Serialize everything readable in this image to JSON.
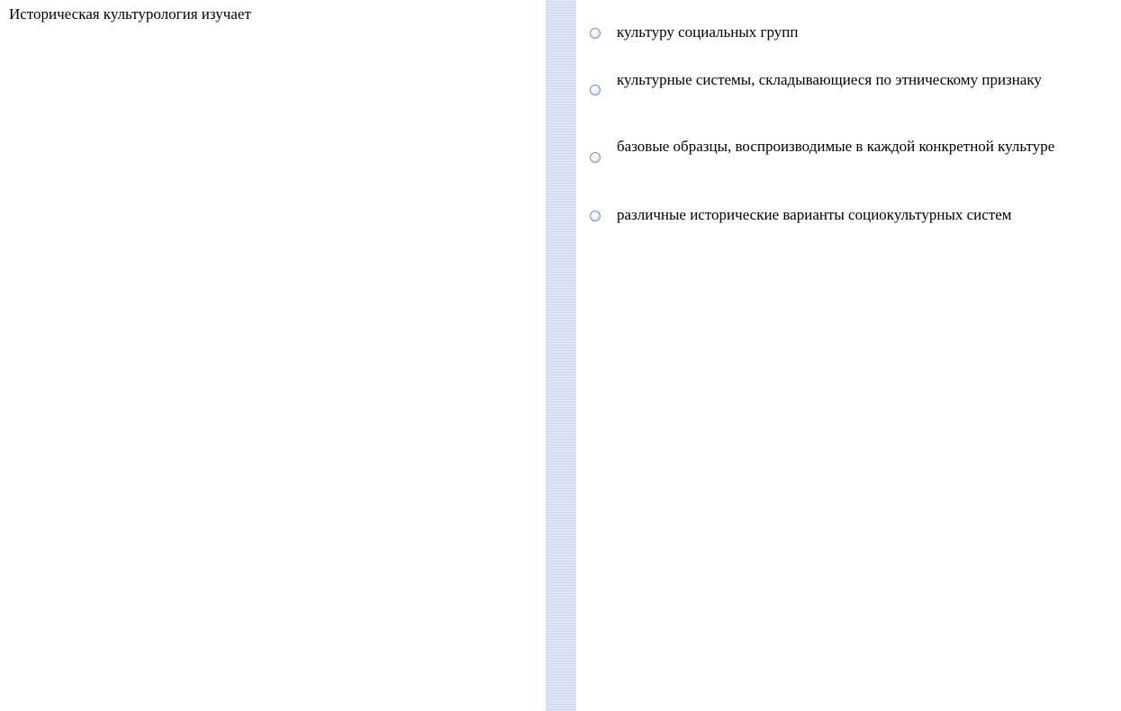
{
  "question": {
    "text": "Историческая культурология изучает"
  },
  "answers": [
    {
      "label": "культуру социальных групп"
    },
    {
      "label": "культурные системы, складывающиеся по этническому признаку"
    },
    {
      "label": "базовые образцы, воспроизводимые в каждой конкретной культуре"
    },
    {
      "label": "различные исторические варианты социокультурных систем"
    }
  ],
  "colors": {
    "divider": "#dfe5f7",
    "radio_border": "#7a96b6"
  }
}
